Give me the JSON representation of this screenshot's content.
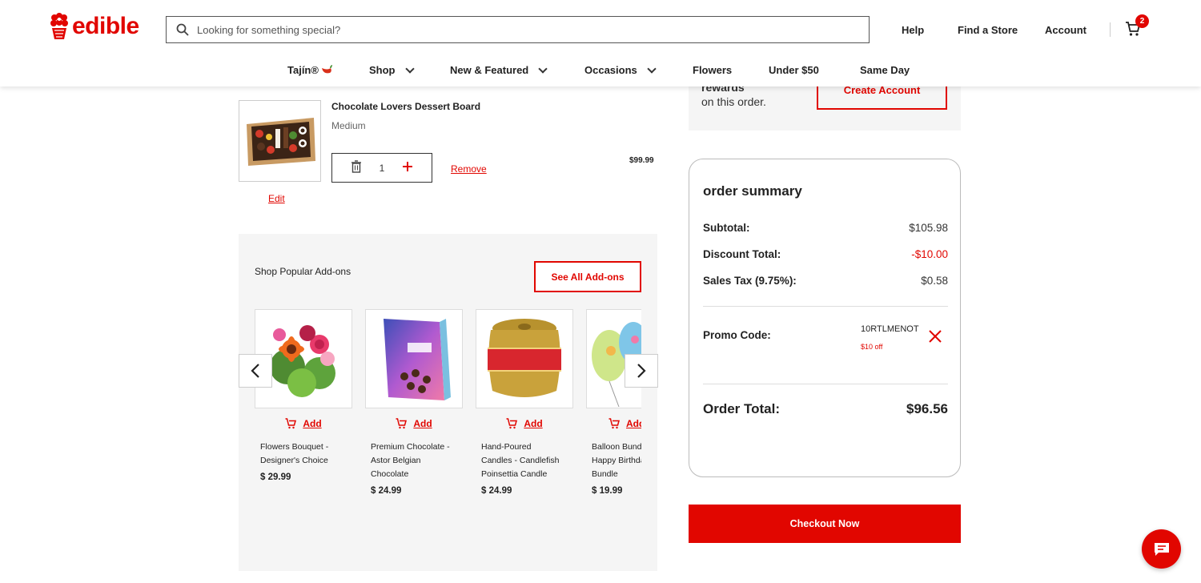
{
  "colors": {
    "accent": "#e10600",
    "panel_bg": "#f5f5f5"
  },
  "header": {
    "logo_text": "edible",
    "search_placeholder": "Looking for something special?",
    "links": [
      "Help",
      "Find a Store",
      "Account"
    ],
    "cart_count": "2"
  },
  "nav": {
    "tajin": "Tajín®",
    "shop": "Shop",
    "new_featured": "New & Featured",
    "occasions": "Occasions",
    "flowers": "Flowers",
    "under50": "Under $50",
    "same_day": "Same Day"
  },
  "rewards": {
    "line1": "rewards",
    "line2": "on this order.",
    "create_account": "Create Account"
  },
  "cart_item": {
    "name": "Chocolate Lovers Dessert Board",
    "size": "Medium",
    "quantity": "1",
    "remove": "Remove",
    "price": "$99.99",
    "edit": "Edit"
  },
  "addons": {
    "title": "Shop Popular Add-ons",
    "see_all": "See All Add-ons",
    "add_label": "Add",
    "items": [
      {
        "name": "Flowers Bouquet - Designer's Choice",
        "price": "$ 29.99",
        "icon": "flower-bouquet-image"
      },
      {
        "name": "Premium Chocolate - Astor Belgian Chocolate",
        "price": "$ 24.99",
        "icon": "chocolate-box-image"
      },
      {
        "name": "Hand-Poured Candles - Candlefish Poinsettia Candle",
        "price": "$ 24.99",
        "icon": "candle-jar-image"
      },
      {
        "name": "Balloon Bundle - Happy Birthday Bundle",
        "name_visible": "Balloon Bun- Happy Birt Bundle",
        "price": "$ 19.99",
        "icon": "balloon-image"
      }
    ]
  },
  "summary": {
    "title": "order summary",
    "subtotal_label": "Subtotal:",
    "subtotal": "$105.98",
    "discount_label": "Discount Total:",
    "discount": "-$10.00",
    "tax_label": "Sales Tax (9.75%):",
    "tax": "$0.58",
    "promo_label": "Promo Code:",
    "promo_code": "10RTLMENOT",
    "promo_off": "$10 off",
    "total_label": "Order Total:",
    "total": "$96.56"
  },
  "checkout_label": "Checkout Now"
}
